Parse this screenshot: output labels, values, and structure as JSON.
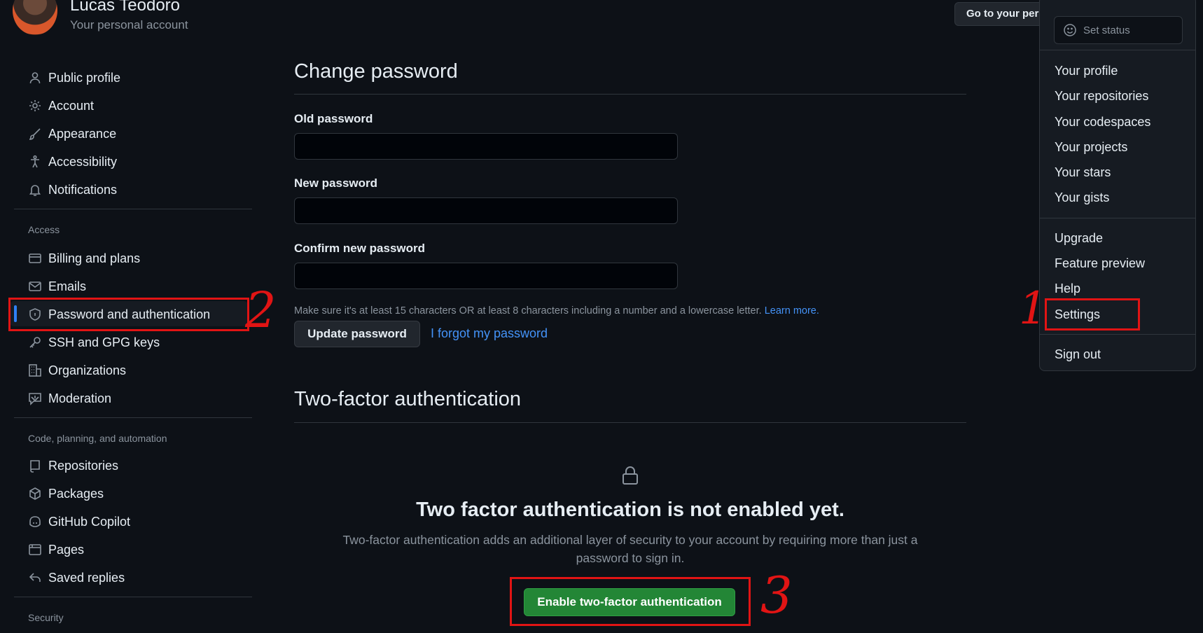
{
  "account": {
    "name": "Lucas Teodoro",
    "subtitle": "Your personal account",
    "goto_label": "Go to your pers"
  },
  "sidebar": {
    "items": [
      {
        "label": "Public profile",
        "icon": "person-icon"
      },
      {
        "label": "Account",
        "icon": "gear-icon"
      },
      {
        "label": "Appearance",
        "icon": "paintbrush-icon"
      },
      {
        "label": "Accessibility",
        "icon": "accessibility-icon"
      },
      {
        "label": "Notifications",
        "icon": "bell-icon"
      }
    ],
    "access_heading": "Access",
    "access_items": [
      {
        "label": "Billing and plans",
        "icon": "credit-card-icon"
      },
      {
        "label": "Emails",
        "icon": "mail-icon"
      },
      {
        "label": "Password and authentication",
        "icon": "shield-lock-icon"
      },
      {
        "label": "SSH and GPG keys",
        "icon": "key-icon"
      },
      {
        "label": "Organizations",
        "icon": "organization-icon"
      },
      {
        "label": "Moderation",
        "icon": "report-icon"
      }
    ],
    "code_heading": "Code, planning, and automation",
    "code_items": [
      {
        "label": "Repositories",
        "icon": "repo-icon"
      },
      {
        "label": "Packages",
        "icon": "package-icon"
      },
      {
        "label": "GitHub Copilot",
        "icon": "copilot-icon"
      },
      {
        "label": "Pages",
        "icon": "browser-icon"
      },
      {
        "label": "Saved replies",
        "icon": "reply-icon"
      }
    ],
    "security_heading": "Security"
  },
  "main": {
    "change_password_title": "Change password",
    "old_password_label": "Old password",
    "new_password_label": "New password",
    "confirm_password_label": "Confirm new password",
    "old_password_value": "",
    "new_password_value": "",
    "confirm_password_value": "",
    "hint_text": "Make sure it's at least 15 characters OR at least 8 characters including a number and a lowercase letter.",
    "learn_more": "Learn more.",
    "update_button": "Update password",
    "forgot_link": "I forgot my password",
    "tfa_section_title": "Two-factor authentication",
    "tfa_status_title": "Two factor authentication is not enabled yet.",
    "tfa_description": "Two-factor authentication adds an additional layer of security to your account by requiring more than just a password to sign in.",
    "enable_button": "Enable two-factor authentication"
  },
  "menu": {
    "set_status": "Set status",
    "group1": [
      "Your profile",
      "Your repositories",
      "Your codespaces",
      "Your projects",
      "Your stars",
      "Your gists"
    ],
    "group2": [
      "Upgrade",
      "Feature preview",
      "Help",
      "Settings"
    ],
    "sign_out": "Sign out"
  },
  "annotations": {
    "step1": "1",
    "step2": "2",
    "step3": "3",
    "color": "#e11414"
  },
  "colors": {
    "background": "#0d1117",
    "accent": "#2f81f7",
    "link": "#4493f8",
    "primary_button": "#238636"
  }
}
